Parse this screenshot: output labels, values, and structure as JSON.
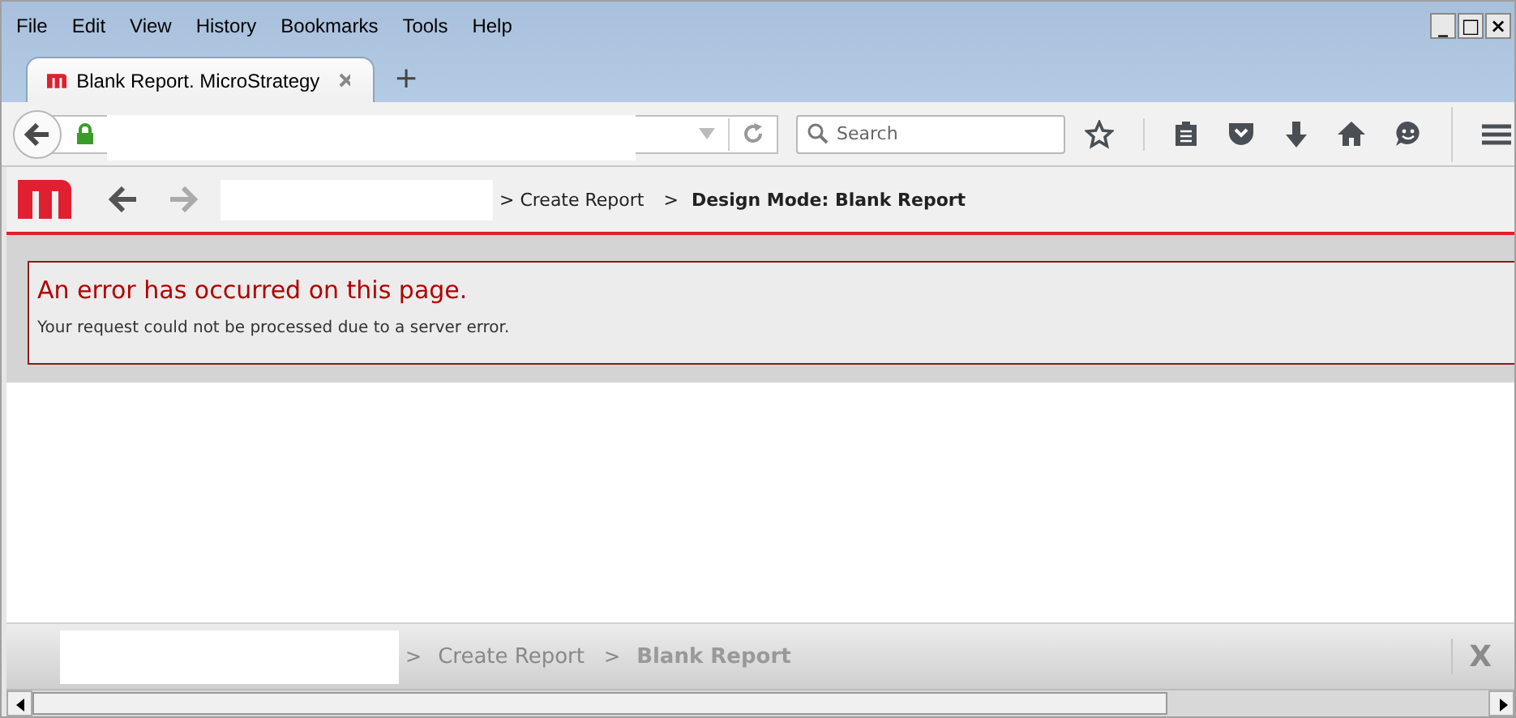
{
  "menu": [
    "File",
    "Edit",
    "View",
    "History",
    "Bookmarks",
    "Tools",
    "Help"
  ],
  "window_controls": [
    "_",
    "□",
    "×"
  ],
  "tabs": [
    {
      "label": "Blank Report. MicroStrategy",
      "selected": true
    }
  ],
  "new_tab": "+",
  "search": {
    "placeholder": "Search"
  },
  "app_header": {
    "breadcrumbs": [
      "> Create Report",
      "  >"
    ],
    "title": "Design Mode: Blank Report"
  },
  "error": {
    "title": "An error has occurred on this page.",
    "message": "Your request could not be processed due to a server error."
  },
  "footer": {
    "breadcrumbs": [
      {
        "label": ">",
        "kind": "sep"
      },
      {
        "label": "Create Report",
        "kind": "link"
      },
      {
        "label": ">",
        "kind": "sep"
      },
      {
        "label": "Blank Report",
        "kind": "current"
      }
    ],
    "close": "X"
  }
}
